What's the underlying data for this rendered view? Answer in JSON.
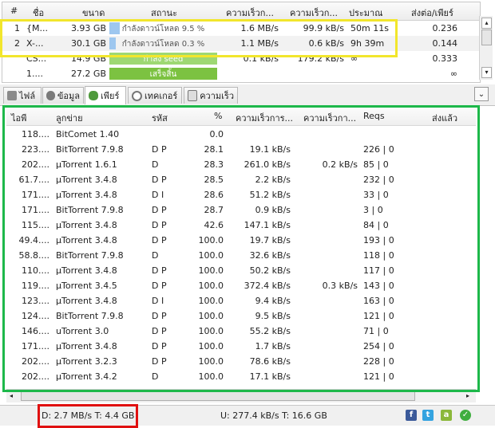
{
  "torrents": {
    "columns": [
      "#",
      "ชื่อ",
      "ขนาด",
      "สถานะ",
      "ความเร็วก...",
      "ความเร็วก...",
      "ประมาณ",
      "ส่งต่อ/เพียร์"
    ],
    "rows": [
      {
        "num": "1",
        "name": "{M...",
        "size": "3.93 GB",
        "status": "กำลังดาวน์โหลด 9.5 %",
        "progress": 0.095,
        "down": "1.6 MB/s",
        "up": "99.9 kB/s",
        "eta": "50m 11s",
        "ratio": "0.236"
      },
      {
        "num": "2",
        "name": "X-...",
        "size": "30.1 GB",
        "status": "กำลังดาวน์โหลด 0.3 %",
        "progress": 0.003,
        "down": "1.1 MB/s",
        "up": "0.6 kB/s",
        "eta": "9h 39m",
        "ratio": "0.144"
      },
      {
        "num": "",
        "name": "CS...",
        "size": "14.9 GB",
        "status": "กำลัง seed",
        "progress": 1.0,
        "down": "0.1 kB/s",
        "up": "179.2 kB/s",
        "eta": "∞",
        "ratio": "0.333"
      },
      {
        "num": "",
        "name": "1....",
        "size": "27.2 GB",
        "status": "เสร็จสิ้น",
        "progress": 1.0,
        "down": "",
        "up": "",
        "eta": "",
        "ratio": "∞"
      }
    ]
  },
  "tabs": [
    {
      "label": "ไฟล์",
      "icon": "files-icon"
    },
    {
      "label": "ข้อมูล",
      "icon": "info-icon"
    },
    {
      "label": "เพียร์",
      "icon": "peers-icon"
    },
    {
      "label": "เทคเกอร์",
      "icon": "trackers-icon"
    },
    {
      "label": "ความเร็ว",
      "icon": "speed-graph-icon"
    }
  ],
  "peers": {
    "columns": [
      "ไอพี",
      "ลูกข่าย",
      "รหัส",
      "%",
      "ความเร็วการ...",
      "ความเร็วกา...",
      "Reqs",
      "ส่งแล้ว"
    ],
    "rows": [
      {
        "ip": "118....",
        "client": "BitComet 1.40",
        "flags": "",
        "pct": "0.0",
        "down": "",
        "up": "",
        "reqs": ""
      },
      {
        "ip": "223....",
        "client": "BitTorrent 7.9.8",
        "flags": "D P",
        "pct": "28.1",
        "down": "19.1 kB/s",
        "up": "",
        "reqs": "226 | 0"
      },
      {
        "ip": "202....",
        "client": "µTorrent 1.6.1",
        "flags": "D",
        "pct": "28.3",
        "down": "261.0 kB/s",
        "up": "0.2 kB/s",
        "reqs": "85 | 0"
      },
      {
        "ip": "61.7....",
        "client": "µTorrent 3.4.8",
        "flags": "D P",
        "pct": "28.5",
        "down": "2.2 kB/s",
        "up": "",
        "reqs": "232 | 0"
      },
      {
        "ip": "171....",
        "client": "µTorrent 3.4.8",
        "flags": "D I",
        "pct": "28.6",
        "down": "51.2 kB/s",
        "up": "",
        "reqs": "33 | 0"
      },
      {
        "ip": "171....",
        "client": "BitTorrent 7.9.8",
        "flags": "D P",
        "pct": "28.7",
        "down": "0.9 kB/s",
        "up": "",
        "reqs": "3 | 0"
      },
      {
        "ip": "115....",
        "client": "µTorrent 3.4.8",
        "flags": "D P",
        "pct": "42.6",
        "down": "147.1 kB/s",
        "up": "",
        "reqs": "84 | 0"
      },
      {
        "ip": "49.4....",
        "client": "µTorrent 3.4.8",
        "flags": "D P",
        "pct": "100.0",
        "down": "19.7 kB/s",
        "up": "",
        "reqs": "193 | 0"
      },
      {
        "ip": "58.8....",
        "client": "BitTorrent 7.9.8",
        "flags": "D",
        "pct": "100.0",
        "down": "32.6 kB/s",
        "up": "",
        "reqs": "118 | 0"
      },
      {
        "ip": "110....",
        "client": "µTorrent 3.4.8",
        "flags": "D P",
        "pct": "100.0",
        "down": "50.2 kB/s",
        "up": "",
        "reqs": "117 | 0"
      },
      {
        "ip": "119....",
        "client": "µTorrent 3.4.5",
        "flags": "D P",
        "pct": "100.0",
        "down": "372.4 kB/s",
        "up": "0.3 kB/s",
        "reqs": "143 | 0"
      },
      {
        "ip": "123....",
        "client": "µTorrent 3.4.8",
        "flags": "D I",
        "pct": "100.0",
        "down": "9.4 kB/s",
        "up": "",
        "reqs": "163 | 0"
      },
      {
        "ip": "124....",
        "client": "BitTorrent 7.9.8",
        "flags": "D P",
        "pct": "100.0",
        "down": "9.5 kB/s",
        "up": "",
        "reqs": "121 | 0"
      },
      {
        "ip": "146....",
        "client": "uTorrent 3.0",
        "flags": "D P",
        "pct": "100.0",
        "down": "55.2 kB/s",
        "up": "",
        "reqs": "71 | 0"
      },
      {
        "ip": "171....",
        "client": "µTorrent 3.4.8",
        "flags": "D P",
        "pct": "100.0",
        "down": "1.7 kB/s",
        "up": "",
        "reqs": "254 | 0"
      },
      {
        "ip": "202....",
        "client": "µTorrent 3.2.3",
        "flags": "D P",
        "pct": "100.0",
        "down": "78.6 kB/s",
        "up": "",
        "reqs": "228 | 0"
      },
      {
        "ip": "202....",
        "client": "µTorrent 3.4.2",
        "flags": "D",
        "pct": "100.0",
        "down": "17.1 kB/s",
        "up": "",
        "reqs": "121 | 0"
      }
    ]
  },
  "status": {
    "download": "D: 2.7 MB/s T: 4.4 GB",
    "upload": "U: 277.4 kB/s T: 16.6 GB"
  },
  "colors": {
    "progress_download": "#9ec7ef",
    "progress_seed": "#9ed873",
    "progress_done": "#7cc241",
    "highlight_yellow": "#f2e62c",
    "highlight_green": "#1db84a",
    "highlight_red": "#e01010"
  }
}
